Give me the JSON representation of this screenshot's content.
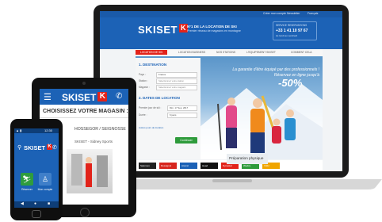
{
  "laptop": {
    "topbar": {
      "link1": "Créer mon compte",
      "link2": "Newsletter",
      "link3": "Français"
    },
    "header": {
      "logo": "SKISET",
      "logo_mark": "K",
      "tagline": "N°1 DE LA LOCATION DE SKI",
      "subtagline": "Premier réseau de magasins en montagne",
      "call": {
        "line1": "SERVICE RESERVATIONS",
        "phone": "+33 1 41 10 97 67",
        "line3": "du lundi au vendredi"
      }
    },
    "nav": [
      "LOCATION DE SKI",
      "LOCATION BUSINESS",
      "NOS STATIONS",
      "L'EQUIPEMENT SKISET",
      "COMMENT CELA"
    ],
    "form": {
      "section1": "1. DESTINATION",
      "pays_label": "Pays :",
      "pays_value": "France",
      "station_label": "Station :",
      "station_value": "Sélectionnez votre station",
      "magasin_label": "Magasin :",
      "magasin_value": "Sélectionnez votre magasin",
      "section2": "2. DATES DE LOCATION",
      "date_label": "Premier jour de ski :",
      "date_value": "Dim. 17 Sep. 2017",
      "duree_label": "Durée :",
      "duree_value": "6 jours",
      "link": "Autres jours de location",
      "submit": "Continuer"
    },
    "promo": {
      "line1": "La garantie d'être équipé par des professionnels !",
      "line2": "Réservez en ligne jusqu'à",
      "percent": "-50%"
    },
    "brands": [
      "Salomon",
      "Rossignol",
      "Atomic",
      "Head",
      "Dynastar",
      "Wedze",
      "Völkl"
    ],
    "brand_colors": [
      "#222222",
      "#d7261e",
      "#1c62b6",
      "#111111",
      "#e2231a",
      "#2e9b3b",
      "#f0a500"
    ],
    "promo_banner": "Préparation physique"
  },
  "tablet": {
    "menu_icon": "hamburger-icon",
    "logo": "SKISET",
    "logo_mark": "K",
    "phone_icon": "phone-icon",
    "heading": "CHOISISSEZ VOTRE MAGASIN :",
    "shop_name": "HOSSEGOR / SEIGNOSSE",
    "shop_sub": "SKISET - Sidney Sports"
  },
  "phone": {
    "status_time": "12:30",
    "status_signal": "▲ ▮",
    "logo": "SKISET",
    "logo_mark": "K",
    "tile1_label": "Réserver",
    "tile2_label": "Mon compte",
    "nav_back": "◀",
    "nav_home": "●",
    "nav_menu": "■"
  }
}
